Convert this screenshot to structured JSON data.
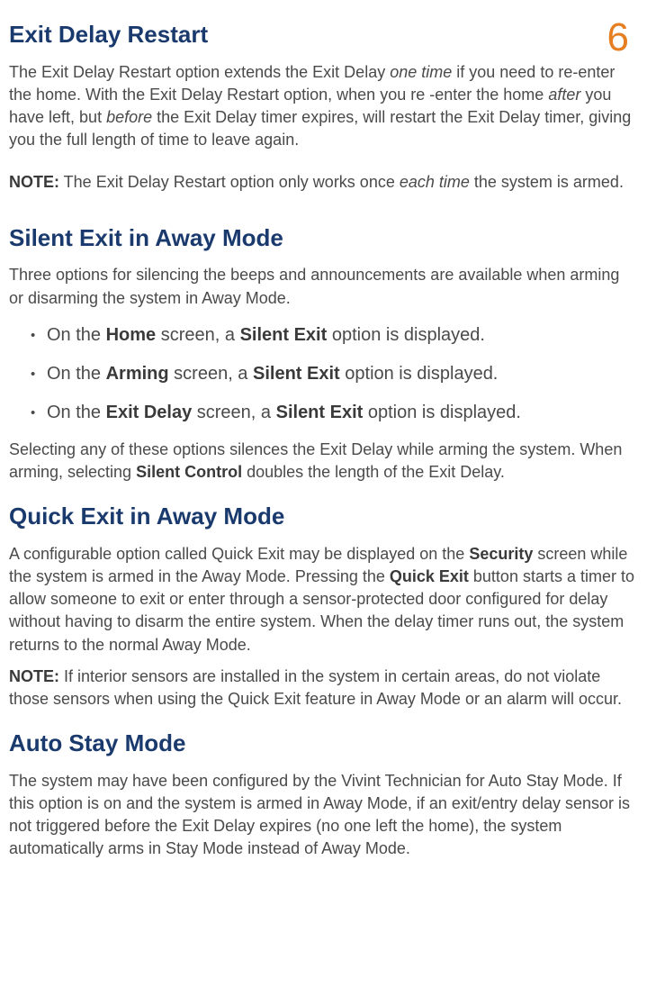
{
  "pageNumber": "6",
  "section1": {
    "heading": "Exit Delay Restart",
    "para1_a": "The Exit Delay Restart option extends the Exit Delay ",
    "para1_em1": "one time",
    "para1_b": " if you need to re-enter the home. With the Exit Delay Restart option, when you re ‑enter the home ",
    "para1_em2": "after",
    "para1_c": " you have left, but ",
    "para1_em3": "before",
    "para1_d": " the Exit Delay timer expires, will restart the Exit Delay timer, giving you the full length of time to leave again.",
    "note_label": "NOTE:",
    "note_a": " The Exit Delay Restart option only works once ",
    "note_em": "each time",
    "note_b": " the system is armed."
  },
  "section2": {
    "heading": "Silent Exit in Away Mode",
    "para1": "Three options for silencing the beeps and announcements are available when arming or disarming the system in Away Mode.",
    "bullets": [
      {
        "a": "On the ",
        "b1": "Home",
        "c": " screen, a ",
        "b2": "Silent Exit",
        "d": " option is displayed."
      },
      {
        "a": "On the ",
        "b1": "Arming",
        "c": " screen, a ",
        "b2": "Silent Exit",
        "d": " option is displayed."
      },
      {
        "a": "On the ",
        "b1": "Exit Delay",
        "c": " screen, a ",
        "b2": "Silent Exit",
        "d": " option is displayed."
      }
    ],
    "para2_a": "Selecting any of these options silences the Exit Delay while arming the system. When arming, selecting ",
    "para2_b": "Silent Control",
    "para2_c": " doubles the length of the Exit Delay."
  },
  "section3": {
    "heading": "Quick Exit in Away Mode",
    "para1_a": "A configurable option called Quick Exit may be displayed on the ",
    "para1_b1": "Security",
    "para1_b": " screen while the system is armed in the Away Mode. Pressing the ",
    "para1_b2": "Quick Exit",
    "para1_c": " button starts a timer to allow someone to exit or enter through a sensor-protected door configured for delay without having to disarm the entire system. When the delay timer runs out, the system returns to the normal Away Mode.",
    "note_label": "NOTE:",
    "note_text": " If interior sensors are installed in the system in certain areas, do not violate those sensors when using the Quick Exit feature in Away Mode or an alarm will occur."
  },
  "section4": {
    "heading": "Auto Stay Mode",
    "para1": "The system may have been configured by the Vivint Technician for Auto Stay Mode. If this option is on and the system is armed in Away Mode, if an exit/entry delay sensor is not triggered before the Exit Delay expires (no one left the home), the system automatically arms in Stay Mode instead of Away Mode."
  }
}
